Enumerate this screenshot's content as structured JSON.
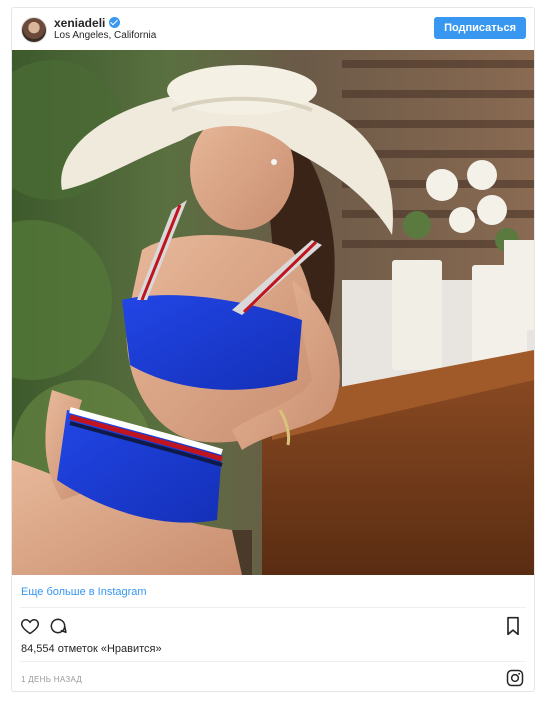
{
  "post": {
    "username": "xeniadeli",
    "location": "Los Angeles, California",
    "follow_label": "Подписаться",
    "more_link": "Еще больше в Instagram",
    "likes": "84,554 отметок «Нравится»",
    "time": "1 ДЕНЬ НАЗАД"
  },
  "icons": {
    "verified": "verified-badge-icon",
    "like": "heart-icon",
    "comment": "comment-bubble-icon",
    "save": "bookmark-icon",
    "instagram": "instagram-logo-icon"
  },
  "colors": {
    "accent": "#3897f0",
    "border": "#e6e6e6",
    "text": "#262626",
    "muted": "#999999"
  }
}
